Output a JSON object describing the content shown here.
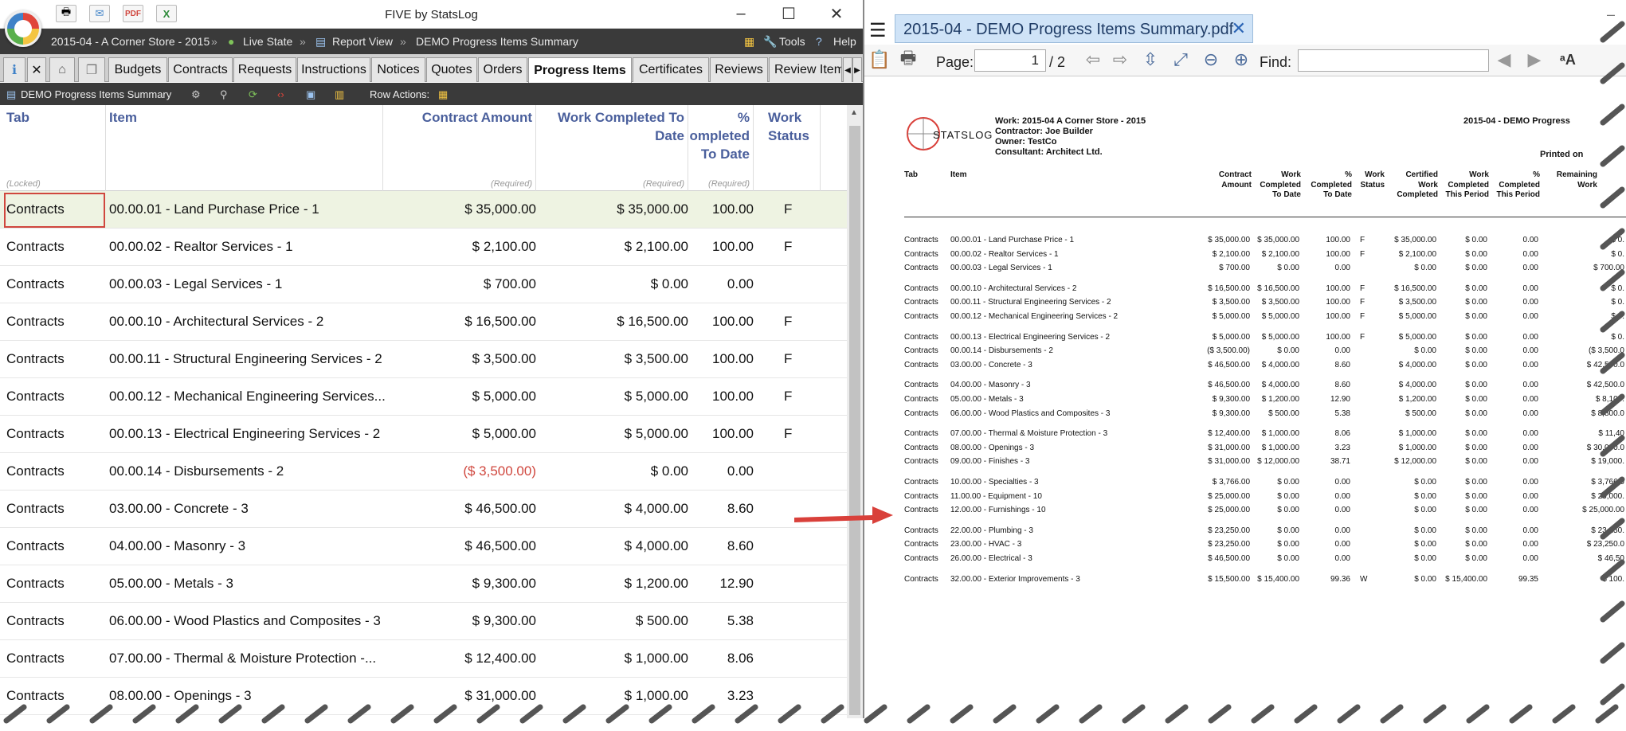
{
  "app": {
    "title": "FIVE by StatsLog",
    "breadcrumb": {
      "project": "2015-04 - A Corner Store - 2015",
      "sep1": "»",
      "state": "Live State",
      "sep2": "»",
      "view": "Report View",
      "sep3": "»",
      "report": "DEMO Progress Items Summary"
    },
    "tools_label": "Tools",
    "help_label": "Help",
    "tabs": [
      "Budgets",
      "Contracts",
      "Requests",
      "Instructions",
      "Notices",
      "Quotes",
      "Orders",
      "Progress Items",
      "Certificates",
      "Reviews",
      "Review Item"
    ],
    "active_tab": "Progress Items",
    "toolbar": {
      "report_name": "DEMO Progress Items Summary",
      "row_actions": "Row Actions:"
    },
    "grid": {
      "columns": [
        {
          "label": "Tab",
          "sub": "(Locked)"
        },
        {
          "label": "Item",
          "sub": ""
        },
        {
          "label": "Contract Amount",
          "sub": "(Required)"
        },
        {
          "label": "Work Completed To Date",
          "line1": "Work Completed To",
          "line2": "Date",
          "sub": "(Required)"
        },
        {
          "label": "% Completed To Date",
          "line1": "%",
          "line2": "ompleted",
          "line3": "To Date",
          "sub": "(Required)"
        },
        {
          "label": "Work Status",
          "line1": "Work",
          "line2": "Status",
          "sub": ""
        }
      ],
      "rows": [
        {
          "tab": "Contracts",
          "item": "00.00.01 - Land Purchase Price - 1",
          "amount": "$ 35,000.00",
          "completed": "$ 35,000.00",
          "pct": "100.00",
          "status": "F"
        },
        {
          "tab": "Contracts",
          "item": "00.00.02 - Realtor Services - 1",
          "amount": "$ 2,100.00",
          "completed": "$ 2,100.00",
          "pct": "100.00",
          "status": "F"
        },
        {
          "tab": "Contracts",
          "item": "00.00.03 - Legal Services - 1",
          "amount": "$ 700.00",
          "completed": "$ 0.00",
          "pct": "0.00",
          "status": ""
        },
        {
          "tab": "Contracts",
          "item": "00.00.10 - Architectural Services - 2",
          "amount": "$ 16,500.00",
          "completed": "$ 16,500.00",
          "pct": "100.00",
          "status": "F"
        },
        {
          "tab": "Contracts",
          "item": "00.00.11 - Structural Engineering Services - 2",
          "amount": "$ 3,500.00",
          "completed": "$ 3,500.00",
          "pct": "100.00",
          "status": "F"
        },
        {
          "tab": "Contracts",
          "item": "00.00.12 - Mechanical Engineering Services...",
          "amount": "$ 5,000.00",
          "completed": "$ 5,000.00",
          "pct": "100.00",
          "status": "F"
        },
        {
          "tab": "Contracts",
          "item": "00.00.13 - Electrical Engineering Services - 2",
          "amount": "$ 5,000.00",
          "completed": "$ 5,000.00",
          "pct": "100.00",
          "status": "F"
        },
        {
          "tab": "Contracts",
          "item": "00.00.14 - Disbursements - 2",
          "amount": "($ 3,500.00)",
          "completed": "$ 0.00",
          "pct": "0.00",
          "status": "",
          "negative": true
        },
        {
          "tab": "Contracts",
          "item": "03.00.00 - Concrete - 3",
          "amount": "$ 46,500.00",
          "completed": "$ 4,000.00",
          "pct": "8.60",
          "status": ""
        },
        {
          "tab": "Contracts",
          "item": "04.00.00 - Masonry - 3",
          "amount": "$ 46,500.00",
          "completed": "$ 4,000.00",
          "pct": "8.60",
          "status": ""
        },
        {
          "tab": "Contracts",
          "item": "05.00.00 - Metals - 3",
          "amount": "$ 9,300.00",
          "completed": "$ 1,200.00",
          "pct": "12.90",
          "status": ""
        },
        {
          "tab": "Contracts",
          "item": "06.00.00 - Wood Plastics and Composites - 3",
          "amount": "$ 9,300.00",
          "completed": "$ 500.00",
          "pct": "5.38",
          "status": ""
        },
        {
          "tab": "Contracts",
          "item": "07.00.00 - Thermal & Moisture Protection -...",
          "amount": "$ 12,400.00",
          "completed": "$ 1,000.00",
          "pct": "8.06",
          "status": ""
        },
        {
          "tab": "Contracts",
          "item": "08.00.00 - Openings - 3",
          "amount": "$ 31,000.00",
          "completed": "$ 1,000.00",
          "pct": "3.23",
          "status": ""
        }
      ]
    }
  },
  "viewer": {
    "tab_title": "2015-04 - DEMO Progress Items Summary.pdf",
    "page_label": "Page:",
    "page_value": "1",
    "page_total": "/ 2",
    "find_label": "Find:",
    "pdf": {
      "logo_text": "STATSLOG",
      "work": "Work: 2015-04 A Corner Store - 2015",
      "contractor": "Contractor: Joe Builder",
      "owner": "Owner: TestCo",
      "consultant": "Consultant: Architect Ltd.",
      "report_title": "2015-04 - DEMO Progress",
      "printed_on": "Printed on",
      "headers": [
        "Tab",
        "Item",
        "Contract Amount",
        "Work Completed To Date",
        "% Completed To Date",
        "Work Status",
        "Certified Work Completed",
        "Work Completed This Period",
        "% Completed This Period",
        "Remaining Work"
      ],
      "rows": [
        [
          "Contracts",
          "00.00.01 - Land Purchase Price - 1",
          "$ 35,000.00",
          "$ 35,000.00",
          "100.00",
          "F",
          "$ 35,000.00",
          "$ 0.00",
          "0.00",
          "$ 0."
        ],
        [
          "Contracts",
          "00.00.02 - Realtor Services - 1",
          "$ 2,100.00",
          "$ 2,100.00",
          "100.00",
          "F",
          "$ 2,100.00",
          "$ 0.00",
          "0.00",
          "$ 0."
        ],
        [
          "Contracts",
          "00.00.03 - Legal Services - 1",
          "$ 700.00",
          "$ 0.00",
          "0.00",
          "",
          "$ 0.00",
          "$ 0.00",
          "0.00",
          "$ 700.00"
        ],
        [
          "Contracts",
          "00.00.10 - Architectural Services - 2",
          "$ 16,500.00",
          "$ 16,500.00",
          "100.00",
          "F",
          "$ 16,500.00",
          "$ 0.00",
          "0.00",
          "$ 0."
        ],
        [
          "Contracts",
          "00.00.11 - Structural Engineering Services - 2",
          "$ 3,500.00",
          "$ 3,500.00",
          "100.00",
          "F",
          "$ 3,500.00",
          "$ 0.00",
          "0.00",
          "$ 0."
        ],
        [
          "Contracts",
          "00.00.12 - Mechanical Engineering Services - 2",
          "$ 5,000.00",
          "$ 5,000.00",
          "100.00",
          "F",
          "$ 5,000.00",
          "$ 0.00",
          "0.00",
          "$ 0."
        ],
        [
          "Contracts",
          "00.00.13 - Electrical Engineering Services - 2",
          "$ 5,000.00",
          "$ 5,000.00",
          "100.00",
          "F",
          "$ 5,000.00",
          "$ 0.00",
          "0.00",
          "$ 0."
        ],
        [
          "Contracts",
          "00.00.14 - Disbursements - 2",
          "($ 3,500.00)",
          "$ 0.00",
          "0.00",
          "",
          "$ 0.00",
          "$ 0.00",
          "0.00",
          "($ 3,500.0"
        ],
        [
          "Contracts",
          "03.00.00 - Concrete - 3",
          "$ 46,500.00",
          "$ 4,000.00",
          "8.60",
          "",
          "$ 4,000.00",
          "$ 0.00",
          "0.00",
          "$ 42,500.0"
        ],
        [
          "Contracts",
          "04.00.00 - Masonry - 3",
          "$ 46,500.00",
          "$ 4,000.00",
          "8.60",
          "",
          "$ 4,000.00",
          "$ 0.00",
          "0.00",
          "$ 42,500.0"
        ],
        [
          "Contracts",
          "05.00.00 - Metals - 3",
          "$ 9,300.00",
          "$ 1,200.00",
          "12.90",
          "",
          "$ 1,200.00",
          "$ 0.00",
          "0.00",
          "$ 8,100."
        ],
        [
          "Contracts",
          "06.00.00 - Wood Plastics and Composites - 3",
          "$ 9,300.00",
          "$ 500.00",
          "5.38",
          "",
          "$ 500.00",
          "$ 0.00",
          "0.00",
          "$ 8,800.0"
        ],
        [
          "Contracts",
          "07.00.00 - Thermal & Moisture Protection - 3",
          "$ 12,400.00",
          "$ 1,000.00",
          "8.06",
          "",
          "$ 1,000.00",
          "$ 0.00",
          "0.00",
          "$ 11,40"
        ],
        [
          "Contracts",
          "08.00.00 - Openings - 3",
          "$ 31,000.00",
          "$ 1,000.00",
          "3.23",
          "",
          "$ 1,000.00",
          "$ 0.00",
          "0.00",
          "$ 30,000.0"
        ],
        [
          "Contracts",
          "09.00.00 - Finishes - 3",
          "$ 31,000.00",
          "$ 12,000.00",
          "38.71",
          "",
          "$ 12,000.00",
          "$ 0.00",
          "0.00",
          "$ 19,000."
        ],
        [
          "Contracts",
          "10.00.00 - Specialties - 3",
          "$ 3,766.00",
          "$ 0.00",
          "0.00",
          "",
          "$ 0.00",
          "$ 0.00",
          "0.00",
          "$ 3,766.0"
        ],
        [
          "Contracts",
          "11.00.00 - Equipment - 10",
          "$ 25,000.00",
          "$ 0.00",
          "0.00",
          "",
          "$ 0.00",
          "$ 0.00",
          "0.00",
          "$ 25,000."
        ],
        [
          "Contracts",
          "12.00.00 - Furnishings - 10",
          "$ 25,000.00",
          "$ 0.00",
          "0.00",
          "",
          "$ 0.00",
          "$ 0.00",
          "0.00",
          "$ 25,000.00"
        ],
        [
          "Contracts",
          "22.00.00 - Plumbing - 3",
          "$ 23,250.00",
          "$ 0.00",
          "0.00",
          "",
          "$ 0.00",
          "$ 0.00",
          "0.00",
          "$ 23,250."
        ],
        [
          "Contracts",
          "23.00.00 - HVAC - 3",
          "$ 23,250.00",
          "$ 0.00",
          "0.00",
          "",
          "$ 0.00",
          "$ 0.00",
          "0.00",
          "$ 23,250.0"
        ],
        [
          "Contracts",
          "26.00.00 - Electrical - 3",
          "$ 46,500.00",
          "$ 0.00",
          "0.00",
          "",
          "$ 0.00",
          "$ 0.00",
          "0.00",
          "$ 46,50"
        ],
        [
          "Contracts",
          "32.00.00 - Exterior Improvements - 3",
          "$ 15,500.00",
          "$ 15,400.00",
          "99.36",
          "W",
          "$ 0.00",
          "$ 15,400.00",
          "99.35",
          "$ 100."
        ]
      ]
    }
  },
  "colors": {
    "accent": "#4a5f9c",
    "negative": "#d0473e",
    "selection": "#eef3e2",
    "arrow": "#d9403a",
    "dark_bar": "#3a3a3a"
  },
  "icons": [
    "app-logo-icon",
    "print-icon",
    "email-icon",
    "pdf-icon",
    "excel-icon",
    "live-state-icon",
    "report-view-icon",
    "grid-icon",
    "tools-icon",
    "help-icon",
    "info-icon",
    "home-icon",
    "copy-icon",
    "settings-icon",
    "refresh-icon",
    "code-icon",
    "chart-icon",
    "filter-icon",
    "hamburger-icon",
    "zoom-in-icon",
    "zoom-out-icon",
    "fit-width-icon",
    "fit-page-icon",
    "prev-page-icon",
    "next-page-icon",
    "text-size-icon"
  ]
}
